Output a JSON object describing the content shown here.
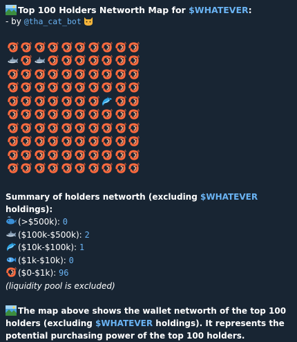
{
  "header": {
    "title_prefix": "Top 100 Holders Networth Map for ",
    "token": "$WHATEVER",
    "title_suffix": ":",
    "by_prefix": "- by ",
    "author": "@tha_cat_bot"
  },
  "grid": {
    "rows": [
      [
        "shrimp",
        "shrimp",
        "shrimp",
        "shrimp",
        "shrimp",
        "shrimp",
        "shrimp",
        "shrimp",
        "shrimp",
        "shrimp"
      ],
      [
        "shark",
        "shrimp",
        "shark",
        "shrimp",
        "shrimp",
        "shrimp",
        "shrimp",
        "shrimp",
        "shrimp",
        "shrimp"
      ],
      [
        "shrimp",
        "shrimp",
        "shrimp",
        "shrimp",
        "shrimp",
        "shrimp",
        "shrimp",
        "shrimp",
        "shrimp",
        "shrimp"
      ],
      [
        "shrimp",
        "shrimp",
        "shrimp",
        "shrimp",
        "shrimp",
        "shrimp",
        "shrimp",
        "shrimp",
        "shrimp",
        "shrimp"
      ],
      [
        "shrimp",
        "shrimp",
        "shrimp",
        "shrimp",
        "shrimp",
        "shrimp",
        "shrimp",
        "dolphin",
        "shrimp",
        "shrimp"
      ],
      [
        "shrimp",
        "shrimp",
        "shrimp",
        "shrimp",
        "shrimp",
        "shrimp",
        "shrimp",
        "shrimp",
        "shrimp",
        "shrimp"
      ],
      [
        "shrimp",
        "shrimp",
        "shrimp",
        "shrimp",
        "shrimp",
        "shrimp",
        "shrimp",
        "shrimp",
        "shrimp",
        "shrimp"
      ],
      [
        "shrimp",
        "shrimp",
        "shrimp",
        "shrimp",
        "shrimp",
        "shrimp",
        "shrimp",
        "shrimp",
        "shrimp",
        "shrimp"
      ],
      [
        "shrimp",
        "shrimp",
        "shrimp",
        "shrimp",
        "shrimp",
        "shrimp",
        "shrimp",
        "shrimp",
        "shrimp",
        "shrimp"
      ],
      [
        "shrimp",
        "shrimp",
        "shrimp",
        "shrimp",
        "shrimp",
        "shrimp",
        "shrimp",
        "shrimp",
        "shrimp",
        "shrimp"
      ]
    ]
  },
  "summary": {
    "heading_prefix": "Summary of holders networth (excluding ",
    "heading_token": "$WHATEVER",
    "heading_suffix": " holdings):",
    "tiers": [
      {
        "icon": "whale",
        "label": "(>$500k): ",
        "count": "0"
      },
      {
        "icon": "shark",
        "label": "($100k-$500k): ",
        "count": "2"
      },
      {
        "icon": "dolphin",
        "label": "($10k-$100k): ",
        "count": "1"
      },
      {
        "icon": "fish",
        "label": "($1k-$10k): ",
        "count": "0"
      },
      {
        "icon": "shrimp",
        "label": "($0-$1k): ",
        "count": "96"
      }
    ],
    "note": "(liquidity pool is excluded)"
  },
  "footer": {
    "part1": "The map above shows the wallet networth of the top 100 holders (excluding ",
    "token": "$WHATEVER",
    "part2": " holdings). It represents the potential purchasing power of the top 100 holders."
  },
  "colors": {
    "background": "#182533",
    "link": "#6ab3f3",
    "text": "#ffffff"
  }
}
